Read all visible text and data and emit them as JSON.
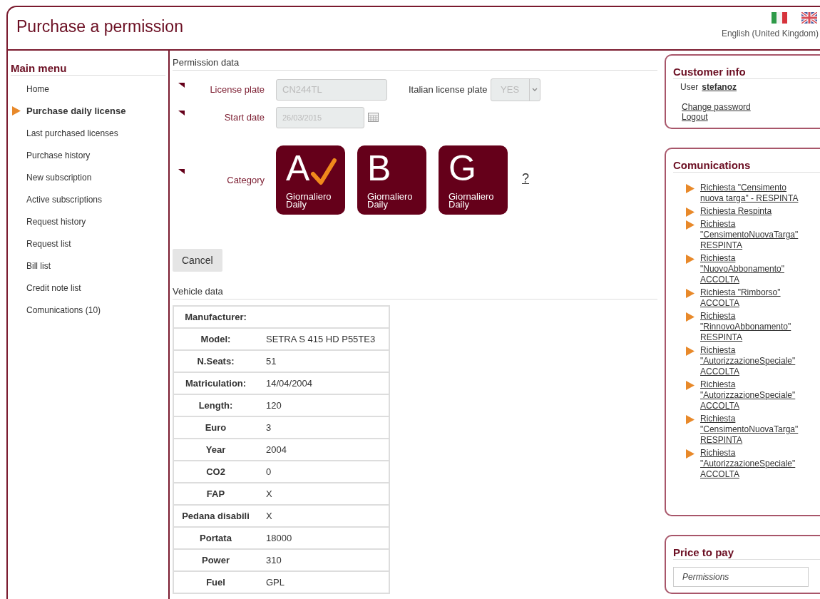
{
  "header": {
    "title": "Purchase a permission",
    "language": "English (United Kingdom)",
    "flags": [
      {
        "kind": "italy",
        "selected": false
      },
      {
        "kind": "uk",
        "selected": true
      }
    ]
  },
  "main_menu": {
    "title": "Main menu",
    "items": [
      {
        "label": "Home",
        "selected": false
      },
      {
        "label": "Purchase daily license",
        "selected": true
      },
      {
        "label": "Last purchased licenses",
        "selected": false
      },
      {
        "label": "Purchase history",
        "selected": false
      },
      {
        "label": "New subscription",
        "selected": false
      },
      {
        "label": "Active subscriptions",
        "selected": false
      },
      {
        "label": "Request history",
        "selected": false
      },
      {
        "label": "Request list",
        "selected": false
      },
      {
        "label": "Bill list",
        "selected": false
      },
      {
        "label": "Credit note list",
        "selected": false
      },
      {
        "label": "Comunications (10)",
        "selected": false
      }
    ]
  },
  "permission_data": {
    "title": "Permission data",
    "license_plate": {
      "label": "License plate",
      "value": "CN244TL",
      "disabled": true
    },
    "italian_plate": {
      "label": "Italian license plate",
      "value": "YES",
      "disabled": true
    },
    "start_date": {
      "label": "Start date",
      "value": "26/03/2015",
      "disabled": true
    },
    "category": {
      "label": "Category",
      "help": "?",
      "options": [
        {
          "letter": "A",
          "line1": "Giornaliero",
          "line2": "Daily",
          "selected": true
        },
        {
          "letter": "B",
          "line1": "Giornaliero",
          "line2": "Daily",
          "selected": false
        },
        {
          "letter": "G",
          "line1": "Giornaliero",
          "line2": "Daily",
          "selected": false
        }
      ]
    },
    "cancel_button": "Cancel"
  },
  "vehicle_data": {
    "title": "Vehicle data",
    "rows": [
      {
        "label": "Manufacturer:"
      },
      {
        "label": "Model:",
        "value": "SETRA S 415 HD P55TE3"
      },
      {
        "label": "N.Seats:",
        "value": "51"
      },
      {
        "label": "Matriculation:",
        "value": "14/04/2004"
      },
      {
        "label": "Length:",
        "value": "120"
      },
      {
        "label": "Euro",
        "value": "3"
      },
      {
        "label": "Year",
        "value": "2004"
      },
      {
        "label": "CO2",
        "value": "0"
      },
      {
        "label": "FAP",
        "value": "X"
      },
      {
        "label": "Pedana disabili",
        "value": "X"
      },
      {
        "label": "Portata",
        "value": "18000"
      },
      {
        "label": "Power",
        "value": "310"
      },
      {
        "label": "Fuel",
        "value": "GPL"
      }
    ]
  },
  "customer_info": {
    "title": "Customer info",
    "user_label": "User",
    "user": "stefanoz",
    "links": [
      "Change password",
      "Logout"
    ]
  },
  "comunications": {
    "title": "Comunications",
    "items": [
      "Richiesta \"Censimento nuova targa\" - RESPINTA",
      "Richiesta Respinta",
      "Richiesta \"CensimentoNuovaTarga\" RESPINTA",
      "Richiesta \"NuovoAbbonamento\" ACCOLTA",
      "Richiesta \"Rimborso\" ACCOLTA",
      "Richiesta \"RinnovoAbbonamento\" RESPINTA",
      "Richiesta \"AutorizzazioneSpeciale\" ACCOLTA",
      "Richiesta \"AutorizzazioneSpeciale\" ACCOLTA",
      "Richiesta \"CensimentoNuovaTarga\" RESPINTA",
      "Richiesta \"AutorizzazioneSpeciale\" ACCOLTA"
    ]
  },
  "price_to_pay": {
    "title": "Price to pay",
    "box_label": "Permissions"
  }
}
